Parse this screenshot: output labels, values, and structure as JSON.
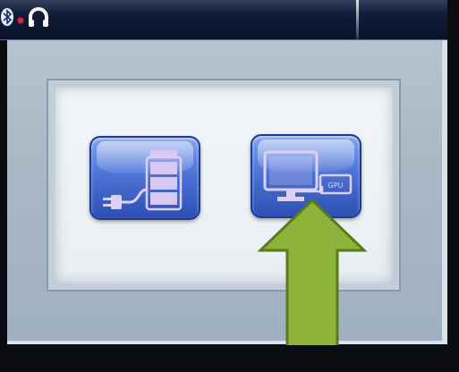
{
  "status_bar": {
    "icons": [
      "bluetooth-icon",
      "headset-icon"
    ]
  },
  "dialog": {
    "options": [
      {
        "id": "power-source",
        "icon": "battery-plug-icon"
      },
      {
        "id": "display-output",
        "icon": "monitor-gpu-icon",
        "badge_text": "GPU"
      }
    ]
  },
  "annotation": {
    "icon": "arrow-up-icon"
  },
  "colors": {
    "status_bar": "#0f1a36",
    "panel": "#aab8c6",
    "tile_blue": "#4d74d6",
    "arrow_fill": "#8db33a",
    "arrow_outline": "#5a7a1e"
  }
}
